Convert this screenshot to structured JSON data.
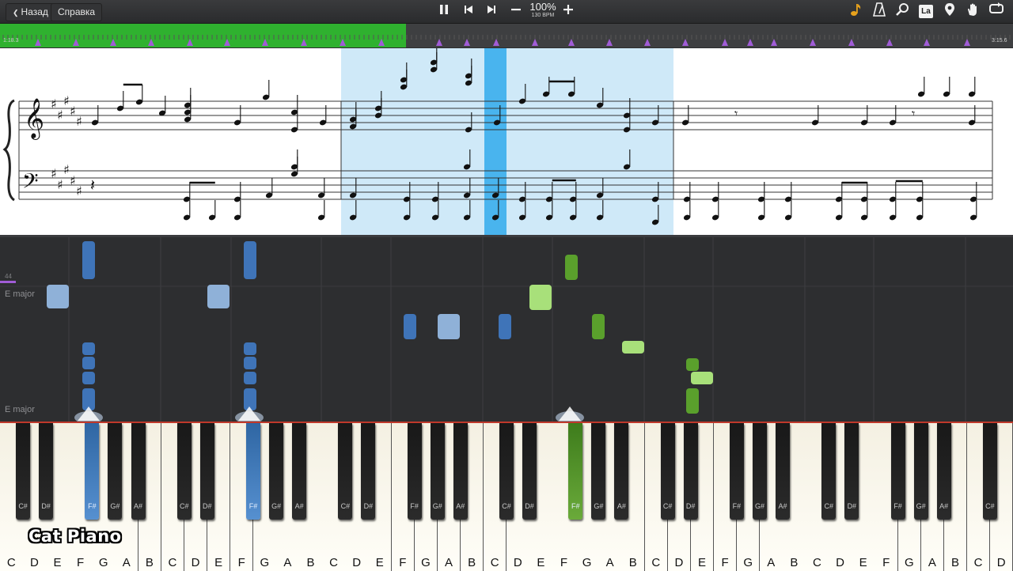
{
  "toolbar": {
    "back_label": "Назад",
    "help_label": "Справка",
    "zoom": "100%",
    "tempo": "130 BPM",
    "icons": [
      "pause-icon",
      "skip-back-icon",
      "skip-forward-icon",
      "minus-icon",
      "plus-icon",
      "note-icon",
      "metronome-icon",
      "magnifier-icon",
      "note-label-icon",
      "marker-icon",
      "hand-icon",
      "loop-icon"
    ],
    "note_label_glyph": "La"
  },
  "timeline": {
    "current_time": "1:18.3",
    "total_time": "3:15.6",
    "progress": 0.4,
    "played_color": "#2fb12f",
    "marker_color": "#a05cd6"
  },
  "sheet": {
    "selection_color": "#cfe9f8",
    "playhead_color": "#49b4ee"
  },
  "roll": {
    "key_label_top": "E major",
    "key_label_bottom": "E major",
    "measure_number": "44",
    "left_hand_color": "#3f74b8",
    "right_hand_color": "#5aa02c"
  },
  "keyboard": {
    "white_labels": [
      "C",
      "D",
      "E",
      "F",
      "G",
      "A",
      "B",
      "C",
      "D",
      "E",
      "F",
      "G",
      "A",
      "B",
      "C",
      "D",
      "E",
      "F",
      "G",
      "A",
      "B",
      "C",
      "D",
      "E",
      "F",
      "G",
      "A",
      "B",
      "C",
      "D",
      "E",
      "F",
      "G",
      "A",
      "B",
      "C",
      "D",
      "E",
      "F",
      "G",
      "A",
      "B",
      "C",
      "D"
    ],
    "black_labels": [
      "C#",
      "D#",
      "F#",
      "G#",
      "A#",
      "C#",
      "D#",
      "F#",
      "G#",
      "A#",
      "C#",
      "D#",
      "F#",
      "G#",
      "A#",
      "C#",
      "D#",
      "F#",
      "G#",
      "A#",
      "C#",
      "D#",
      "F#",
      "G#",
      "A#",
      "C#",
      "D#",
      "F#",
      "G#",
      "A#",
      "C#"
    ],
    "pressed_blue": [
      2,
      7
    ],
    "pressed_green": [
      17
    ]
  },
  "watermark": "Cat Piano"
}
